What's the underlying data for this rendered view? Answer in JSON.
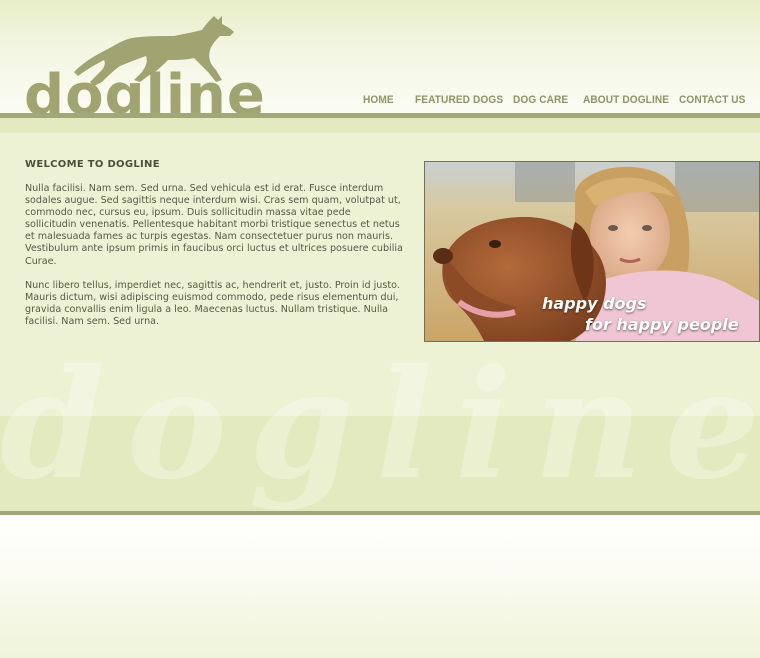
{
  "brand": {
    "logo_text": "dogline",
    "logo_icon": "running-dog-icon",
    "color": "#a0a471"
  },
  "nav": {
    "items": [
      "HOME",
      "FEATURED DOGS",
      "DOG CARE",
      "ABOUT DOGLINE",
      "CONTACT US"
    ]
  },
  "main": {
    "title": "WELCOME TO DOGLINE",
    "paragraphs": [
      "Nulla facilisi. Nam sem. Sed urna. Sed vehicula est id erat. Fusce interdum sodales augue. Sed sagittis neque interdum wisi. Cras sem quam, volutpat ut, commodo nec, cursus eu, ipsum. Duis sollicitudin massa vitae pede sollicitudin venenatis. Pellentesque habitant morbi tristique senectus et netus et malesuada fames ac turpis egestas. Nam consectetuer purus non mauris. Vestibulum ante ipsum primis in faucibus orci luctus et ultrices posuere cubilia Curae.",
      "Nunc libero tellus, imperdiet nec, sagittis ac, hendrerit et, justo. Proin id justo. Mauris dictum, wisi adipiscing euismod commodo, pede risus elementum dui, gravida convallis enim ligula a leo. Maecenas luctus. Nullam tristique. Nulla facilisi. Nam sem. Sed urna."
    ]
  },
  "hero": {
    "tagline_line1": "happy dogs",
    "tagline_line2": "for happy people",
    "image": "girl-with-dog-photo"
  },
  "watermark": "dogline",
  "colors": {
    "accent": "#a3a677",
    "band": "#e3eabf",
    "content": "#edf2d5",
    "text": "#575a44"
  }
}
